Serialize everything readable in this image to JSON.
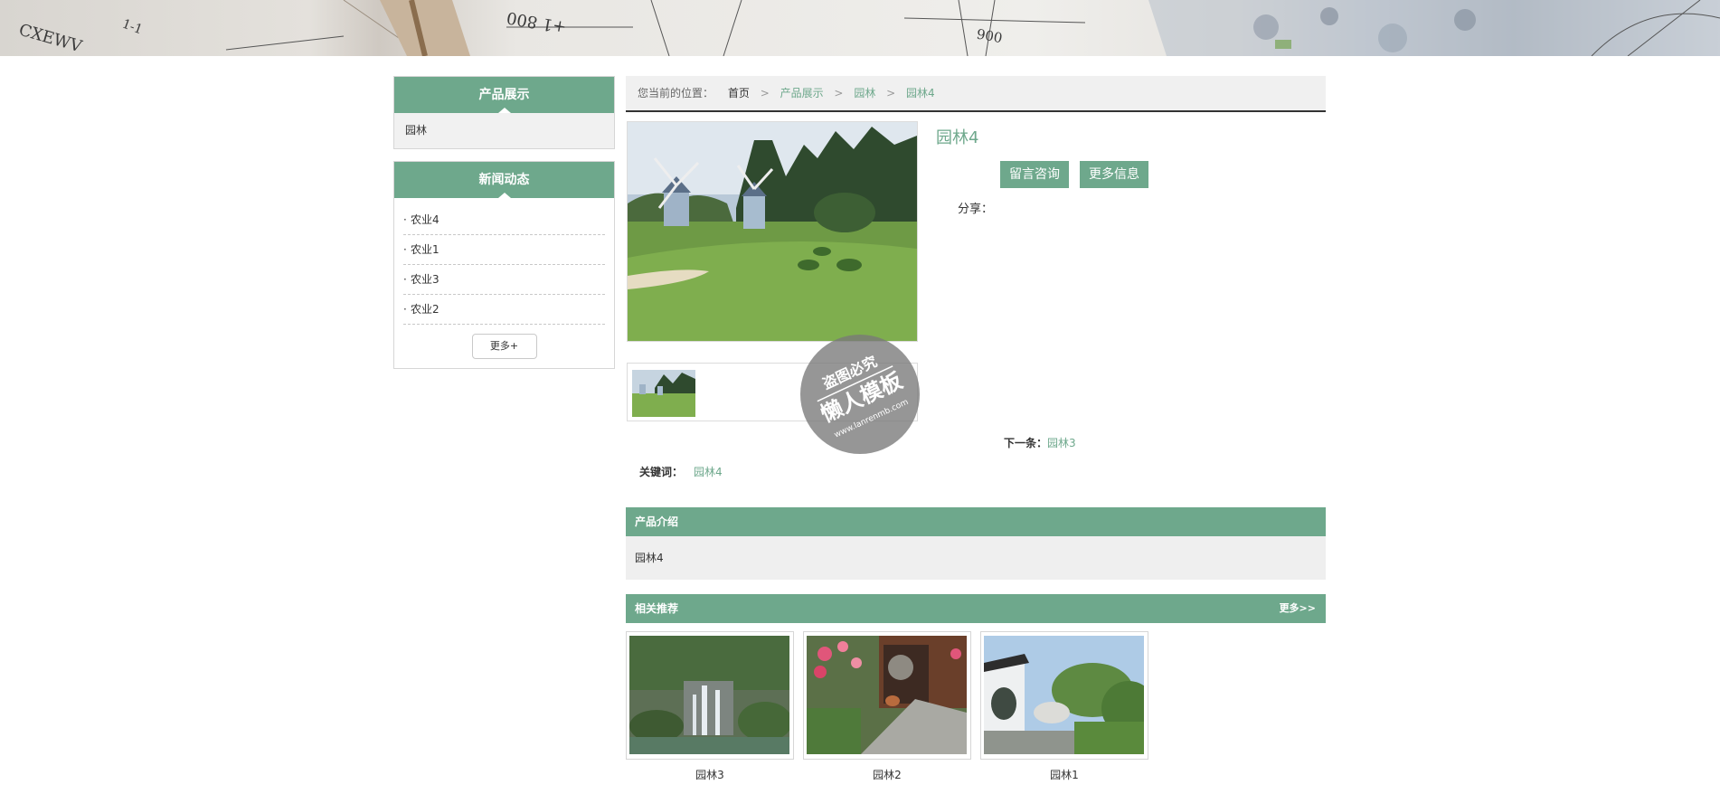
{
  "banner": {
    "text1": "CXEWV",
    "text2": "1-1",
    "text3": "+1 800",
    "text4": "006"
  },
  "sidebar": {
    "products": {
      "title": "产品展示",
      "items": [
        {
          "label": "园林"
        }
      ]
    },
    "news": {
      "title": "新闻动态",
      "items": [
        {
          "label": "农业4"
        },
        {
          "label": "农业1"
        },
        {
          "label": "农业3"
        },
        {
          "label": "农业2"
        }
      ],
      "more_label": "更多+"
    }
  },
  "breadcrumb": {
    "label": "您当前的位置：",
    "home": "首页",
    "sep": ">",
    "items": [
      "产品展示",
      "园林",
      "园林4"
    ]
  },
  "product": {
    "title": "园林4",
    "consult_button": "留言咨询",
    "more_info_button": "更多信息",
    "share_label": "分享：",
    "next_label": "下一条：",
    "next_link": "园林3",
    "keywords_label": "关键词：",
    "keyword": "园林4"
  },
  "intro": {
    "title": "产品介绍",
    "body": "园林4"
  },
  "related": {
    "title": "相关推荐",
    "more_label": "更多>>",
    "items": [
      {
        "caption": "园林3"
      },
      {
        "caption": "园林2"
      },
      {
        "caption": "园林1"
      }
    ]
  },
  "watermark": {
    "line1": "盗图必究",
    "line2": "懒人模板",
    "line3": "www.lanrenmb.com"
  },
  "colors": {
    "accent": "#6ea88c",
    "light_bg": "#f0f0f0",
    "dark_rule": "#333333"
  }
}
